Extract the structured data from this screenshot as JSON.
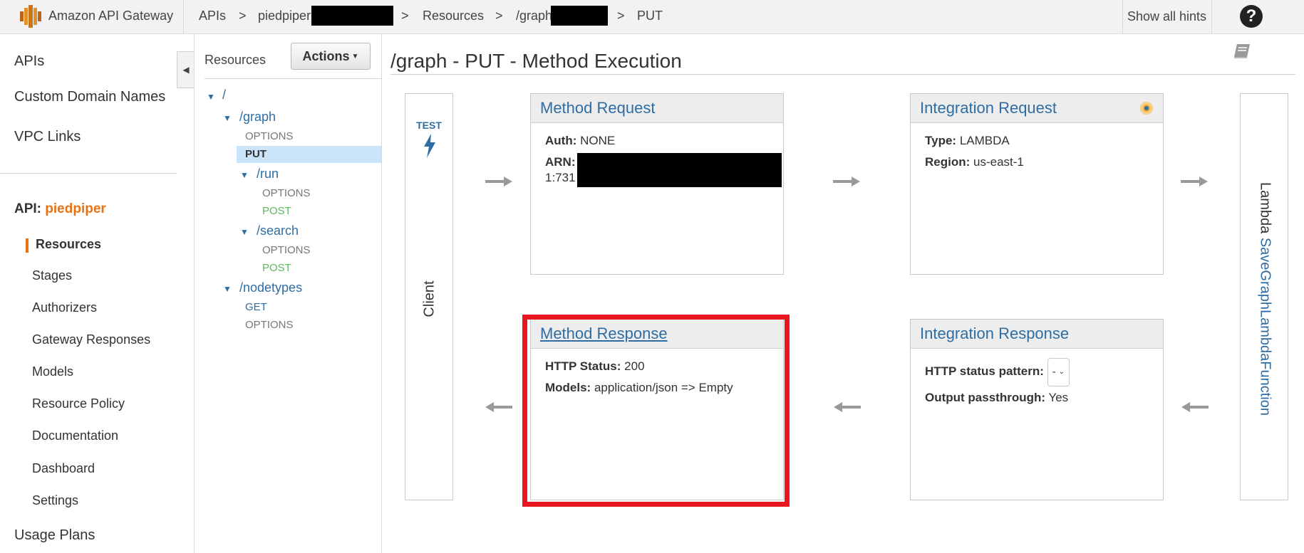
{
  "topbar": {
    "brand": "Amazon API Gateway",
    "breadcrumbs": [
      "APIs",
      ">",
      "piedpiper",
      ">",
      "Resources",
      ">",
      "/graph",
      ">",
      "PUT"
    ],
    "hints": "Show all hints",
    "help": "?"
  },
  "nav": {
    "main_items": [
      "APIs",
      "Custom Domain Names",
      "VPC Links"
    ],
    "api_prefix": "API:",
    "api_name": "piedpiper",
    "sub_items": [
      "Resources",
      "Stages",
      "Authorizers",
      "Gateway Responses",
      "Models",
      "Resource Policy",
      "Documentation",
      "Dashboard",
      "Settings"
    ],
    "usage_plans": "Usage Plans"
  },
  "resources": {
    "title": "Resources",
    "actions": "Actions",
    "tree": {
      "root": "/",
      "graph": "/graph",
      "graph_options": "OPTIONS",
      "graph_put": "PUT",
      "run": "/run",
      "run_options": "OPTIONS",
      "run_post": "POST",
      "search": "/search",
      "search_options": "OPTIONS",
      "search_post": "POST",
      "nodetypes": "/nodetypes",
      "nodetypes_get": "GET",
      "nodetypes_options": "OPTIONS"
    }
  },
  "main": {
    "title": "/graph - PUT - Method Execution",
    "test": "TEST",
    "client": "Client",
    "lambda_prefix": "Lambda",
    "lambda_fn": "SaveGraphLambdaFunction",
    "method_request": {
      "title": "Method Request",
      "auth_label": "Auth:",
      "auth_value": "NONE",
      "arn_label": "ARN:",
      "arn_value": "1:731"
    },
    "integration_request": {
      "title": "Integration Request",
      "type_label": "Type:",
      "type_value": "LAMBDA",
      "region_label": "Region:",
      "region_value": "us-east-1"
    },
    "method_response": {
      "title": "Method Response",
      "status_label": "HTTP Status:",
      "status_value": "200",
      "models_label": "Models:",
      "models_value": "application/json => Empty"
    },
    "integration_response": {
      "title": "Integration Response",
      "pattern_label": "HTTP status pattern:",
      "pattern_value": "-",
      "passthrough_label": "Output passthrough:",
      "passthrough_value": "Yes"
    }
  },
  "colors": {
    "accent": "#ec7211",
    "link": "#2e6da4",
    "highlight": "#e8161f",
    "post": "#5cb85c"
  },
  "icons": [
    "api-gateway-logo-icon",
    "help-icon",
    "collapse-left-icon",
    "caret-down-icon",
    "book-icon",
    "lightning-bolt-icon",
    "arrow-right-icon",
    "arrow-left-icon",
    "status-indicator-icon",
    "chevron-down-icon"
  ]
}
